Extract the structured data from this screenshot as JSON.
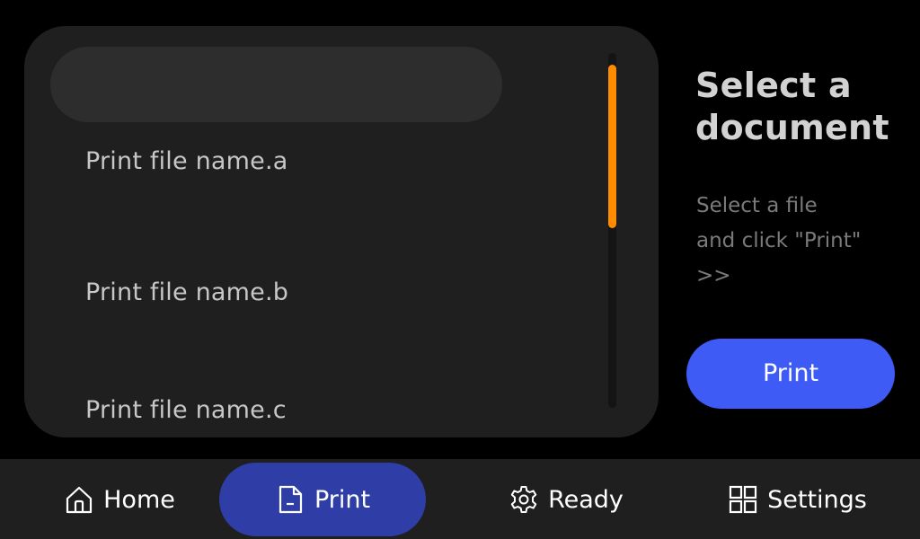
{
  "file_list": {
    "search_value": "",
    "items": [
      {
        "label": "Print file name.a"
      },
      {
        "label": "Print file name.b"
      },
      {
        "label": "Print file name.c"
      }
    ],
    "scroll_position": 0.05,
    "visible_fraction": 0.46
  },
  "info": {
    "title": "Select a document",
    "description": "Select a file\nand click \"Print\"\n>>",
    "print_button_label": "Print"
  },
  "nav": {
    "items": [
      {
        "label": "Home",
        "icon": "home-icon"
      },
      {
        "label": "Print",
        "icon": "document-icon",
        "active": true
      },
      {
        "label": "Ready",
        "icon": "gear-icon"
      },
      {
        "label": "Settings",
        "icon": "grid-icon"
      }
    ]
  },
  "colors": {
    "background": "#000000",
    "panel": "#1f1f1f",
    "accent_scrollbar": "#ff8c00",
    "primary_button": "#3e5cf5",
    "nav_active": "#2f3ea6"
  }
}
